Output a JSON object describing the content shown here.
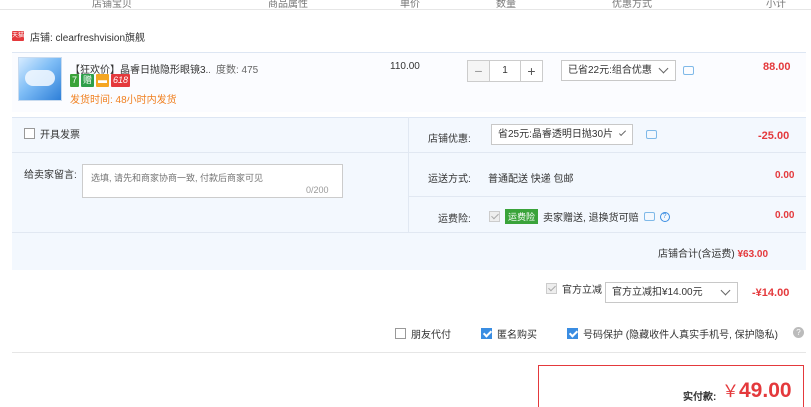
{
  "header": {
    "columns": [
      "店铺宝贝",
      "商品属性",
      "单价",
      "数量",
      "优惠方式",
      "小计"
    ]
  },
  "shop": {
    "icon_label": "天猫",
    "name": "店铺: clearfreshvision旗舰"
  },
  "item": {
    "title": "【狂欢价】晶睿日抛隐形眼镜3...",
    "spec": "度数: 475",
    "badges": [
      {
        "text": "7",
        "color": "#3aa33a"
      },
      {
        "text": "赠",
        "color": "#2d9f4a"
      },
      {
        "text": "▬",
        "color": "#f5a623"
      },
      {
        "text": "618",
        "color": "#e4393c"
      }
    ],
    "ship_time": "发货时间: 48小时内发货",
    "price": "110.00",
    "qty": "1",
    "minus": "−",
    "plus": "+",
    "discount_select": "已省22元:组合优惠",
    "subtotal": "88.00"
  },
  "invoice": {
    "label": "开具发票"
  },
  "message": {
    "label": "给卖家留言:",
    "placeholder": "选填, 请先和商家协商一致, 付款后商家可见",
    "count": "0/200"
  },
  "shop_discount": {
    "label": "店铺优惠:",
    "select": "省25元:晶睿透明日抛30片",
    "value": "-25.00"
  },
  "shipping": {
    "label": "运送方式:",
    "method": "普通配送 快递 包邮",
    "value": "0.00"
  },
  "insurance": {
    "label": "运费险:",
    "tag": "运费险",
    "text": "卖家赠送, 退换货可赔",
    "help": "?",
    "value": "0.00"
  },
  "shop_total": {
    "label": "店铺合计(含运费)",
    "value": "¥63.00"
  },
  "official": {
    "label": "官方立减",
    "select": "官方立减扣¥14.00元",
    "value": "-¥14.00"
  },
  "options": {
    "friend_pay": "朋友代付",
    "anonymous": "匿名购买",
    "privacy": "号码保护 (隐藏收件人真实手机号, 保护隐私)",
    "help": "?"
  },
  "payment": {
    "label": "实付款:",
    "yen": "￥",
    "amount": "49.00"
  },
  "colors": {
    "accent_red": "#e4393c",
    "link_blue": "#3a8de2",
    "panel_blue": "#f3f8fe",
    "orange": "#f07f1e"
  }
}
